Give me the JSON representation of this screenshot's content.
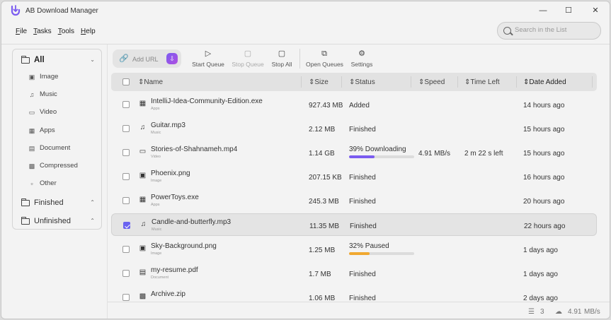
{
  "window": {
    "title": "AB Download Manager",
    "minimize": "—",
    "maximize": "☐",
    "close": "✕"
  },
  "menu": [
    {
      "u": "F",
      "rest": "ile"
    },
    {
      "u": "T",
      "rest": "asks"
    },
    {
      "u": "T",
      "rest": "ools"
    },
    {
      "u": "H",
      "rest": "elp"
    }
  ],
  "search": {
    "placeholder": "Search in the List"
  },
  "sidebar": {
    "all": "All",
    "types": [
      "Image",
      "Music",
      "Video",
      "Apps",
      "Document",
      "Compressed",
      "Other"
    ],
    "finished": "Finished",
    "unfinished": "Unfinished"
  },
  "toolbar": {
    "add_url": "Add URL",
    "start_queue": "Start Queue",
    "stop_queue": "Stop Queue",
    "stop_all": "Stop All",
    "open_queues": "Open Queues",
    "settings": "Settings"
  },
  "columns": {
    "name": "Name",
    "size": "Size",
    "status": "Status",
    "speed": "Speed",
    "time_left": "Time Left",
    "date_added": "Date Added"
  },
  "rows": [
    {
      "name": "IntelliJ-Idea-Community-Edition.exe",
      "type": "Apps",
      "size": "927.43 MB",
      "status": "Added",
      "speed": "",
      "time_left": "",
      "date": "14 hours ago"
    },
    {
      "name": "Guitar.mp3",
      "type": "Music",
      "size": "2.12 MB",
      "status": "Finished",
      "speed": "",
      "time_left": "",
      "date": "15 hours ago"
    },
    {
      "name": "Stories-of-Shahnameh.mp4",
      "type": "Video",
      "size": "1.14 GB",
      "status": "39% Downloading",
      "progress": 0.39,
      "speed": "4.91 MB/s",
      "time_left": "2 m 22 s left",
      "date": "15 hours ago"
    },
    {
      "name": "Phoenix.png",
      "type": "Image",
      "size": "207.15 KB",
      "status": "Finished",
      "speed": "",
      "time_left": "",
      "date": "16 hours ago"
    },
    {
      "name": "PowerToys.exe",
      "type": "Apps",
      "size": "245.3 MB",
      "status": "Finished",
      "speed": "",
      "time_left": "",
      "date": "20 hours ago"
    },
    {
      "name": "Candle-and-butterfly.mp3",
      "type": "Music",
      "size": "11.35 MB",
      "status": "Finished",
      "speed": "",
      "time_left": "",
      "date": "22 hours ago"
    },
    {
      "name": "Sky-Background.png",
      "type": "Image",
      "size": "1.25 MB",
      "status": "32% Paused",
      "progress": 0.32,
      "speed": "",
      "time_left": "",
      "date": "1 days ago"
    },
    {
      "name": "my-resume.pdf",
      "type": "Document",
      "size": "1.7 MB",
      "status": "Finished",
      "speed": "",
      "time_left": "",
      "date": "1 days ago"
    },
    {
      "name": "Archive.zip",
      "type": "",
      "size": "1.06 MB",
      "status": "Finished",
      "speed": "",
      "time_left": "",
      "date": "2 days ago"
    }
  ],
  "status": {
    "active_count": "3",
    "total_speed": "4.91",
    "speed_unit": "MB/s"
  },
  "colors": {
    "accent": "#6a63f0",
    "downloading": "#7b5cf0",
    "paused": "#f0a830"
  }
}
